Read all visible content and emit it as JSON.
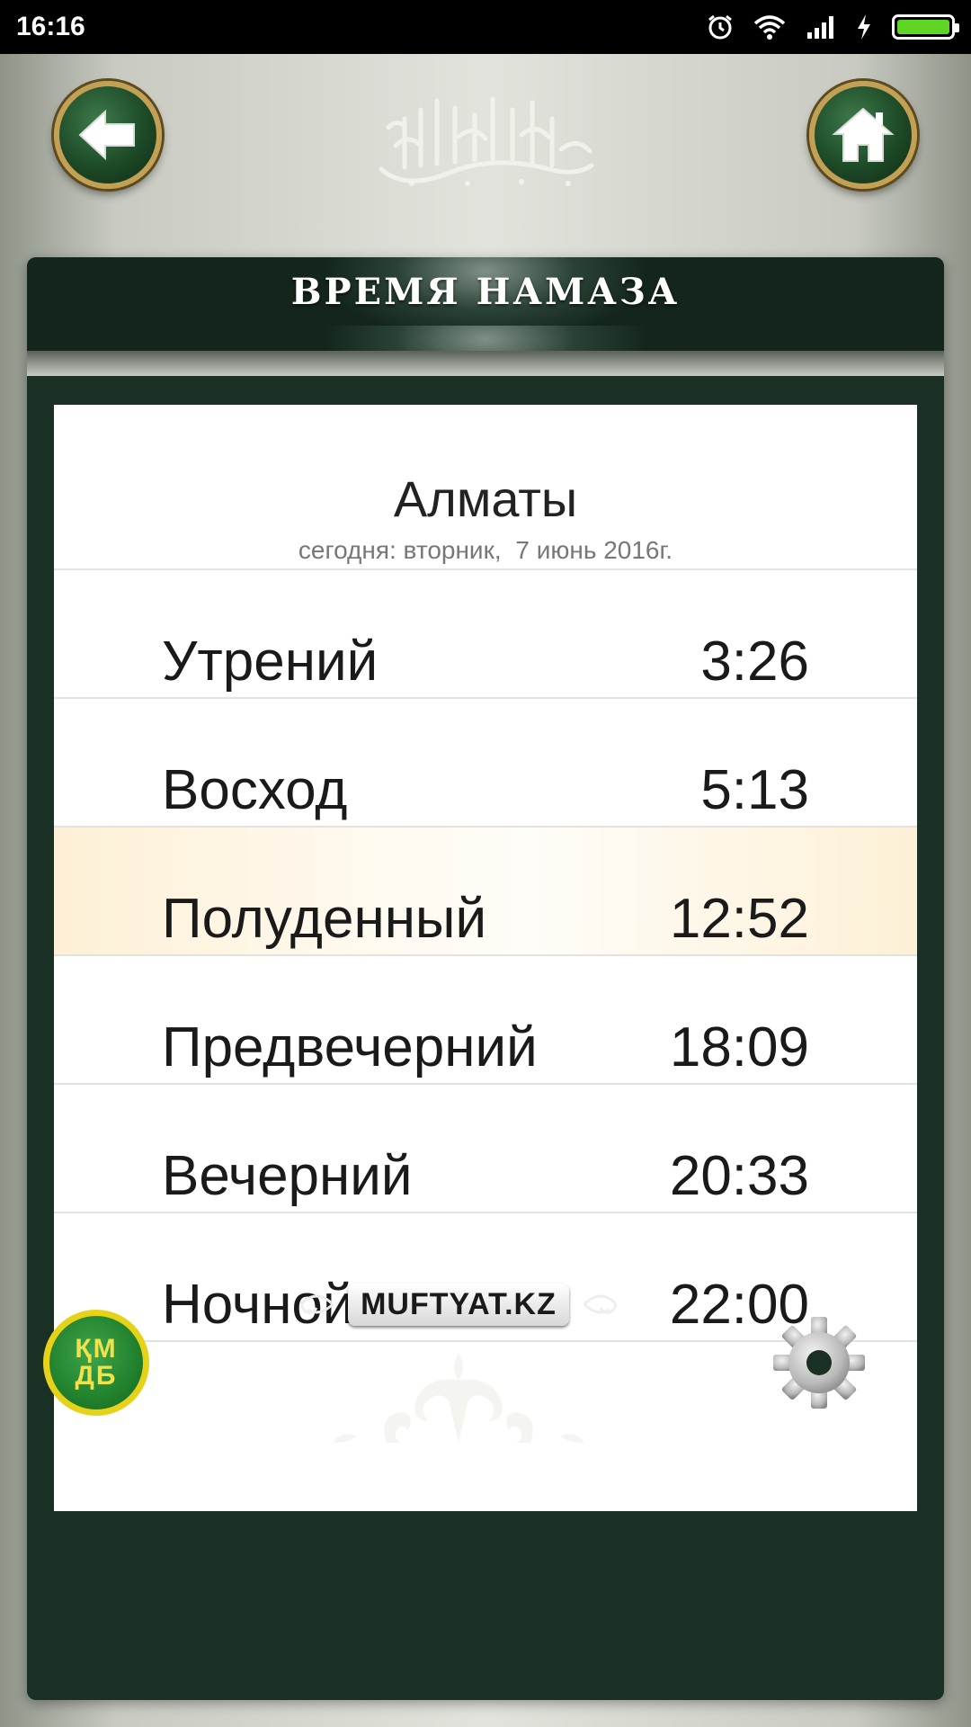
{
  "status_bar": {
    "time": "16:16",
    "icons": [
      "alarm-icon",
      "wifi-icon",
      "signal-icon",
      "charging-icon",
      "battery-icon"
    ],
    "battery_color": "#5ed623"
  },
  "header": {
    "back_icon": "back-arrow-icon",
    "home_icon": "home-icon",
    "calligraphy": "bismillah-calligraphy"
  },
  "panel": {
    "title": "ВРЕМЯ НАМАЗА"
  },
  "location": {
    "city": "Алматы",
    "date_prefix": "сегодня: вторник,",
    "date": "7 июнь 2016г."
  },
  "prayers": [
    {
      "name": "Утрений",
      "time": "3:26",
      "highlighted": false
    },
    {
      "name": "Восход",
      "time": "5:13",
      "highlighted": false
    },
    {
      "name": "Полуденный",
      "time": "12:52",
      "highlighted": true
    },
    {
      "name": "Предвечерний",
      "time": "18:09",
      "highlighted": false
    },
    {
      "name": "Вечерний",
      "time": "20:33",
      "highlighted": false
    },
    {
      "name": "Ночной",
      "time": "22:00",
      "highlighted": false
    }
  ],
  "footer": {
    "logo_text_top": "ҚМ",
    "logo_text_bottom": "ДБ",
    "site": "MUFTYAT.KZ",
    "settings_icon": "gear-icon"
  },
  "colors": {
    "panel_dark_green": "#1b3025",
    "button_gold_rim": "#c2a054",
    "highlight_row": "#fdf0d6",
    "logo_yellow": "#e7d21a"
  }
}
